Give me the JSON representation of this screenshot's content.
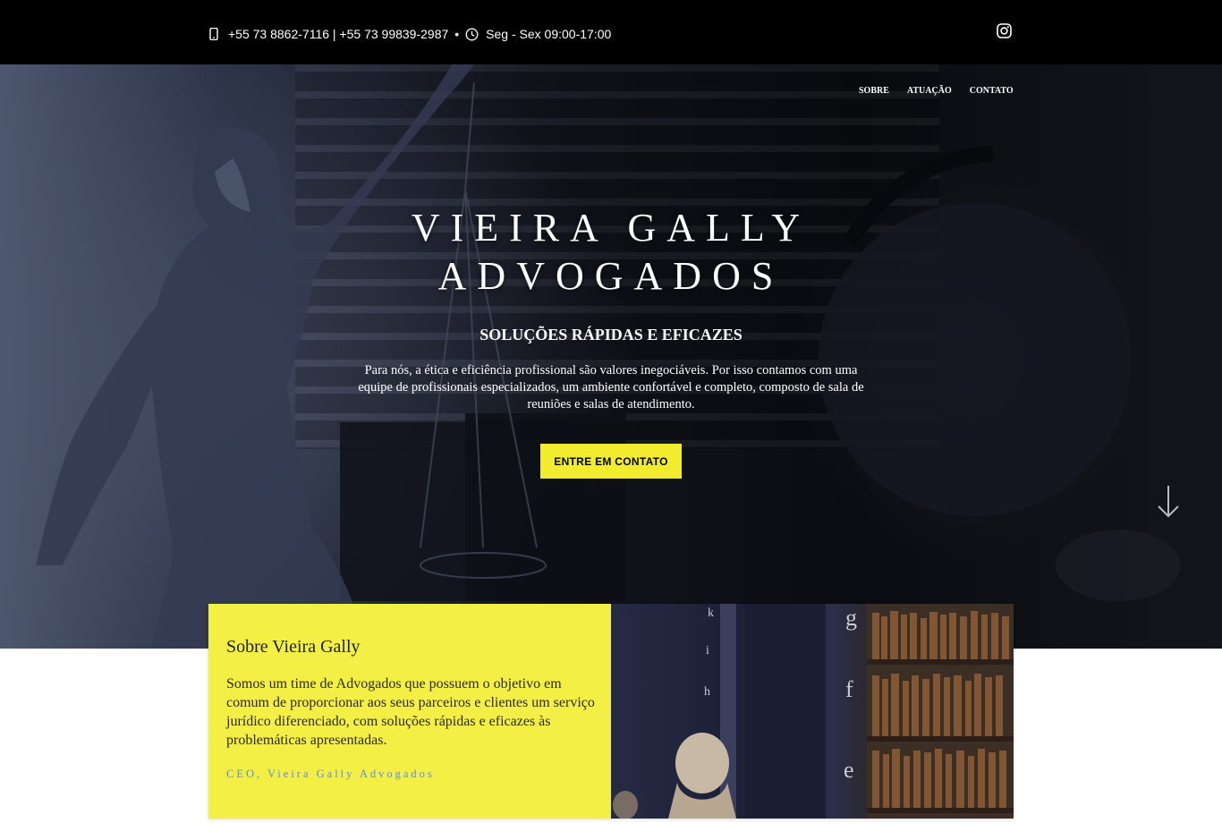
{
  "topbar": {
    "phones": "+55 73 8862-7116 | +55 73 99839-2987",
    "separator": "•",
    "hours": "Seg - Sex 09:00-17:00",
    "icons": [
      "phone-icon",
      "clock-icon",
      "instagram-icon"
    ]
  },
  "nav": {
    "items": [
      {
        "label": "SOBRE"
      },
      {
        "label": "ATUAÇÃO"
      },
      {
        "label": "CONTATO"
      }
    ]
  },
  "hero": {
    "title_line1": "VIEIRA GALLY",
    "title_line2": "ADVOGADOS",
    "subtitle": "SOLUÇÕES RÁPIDAS E EFICAZES",
    "text": "Para nós, a ética e eficiência profissional são valores inegociáveis. Por isso contamos com uma equipe de profissionais especializados, um ambiente confortável e completo, composto de sala de reuniões e salas de atendimento.",
    "cta_label": "ENTRE EM CONTATO"
  },
  "about": {
    "title": "Sobre Vieira Gally",
    "text": "Somos um time de Advogados que possuem o objetivo em comum de proporcionar aos seus parceiros e clientes um serviço jurídico diferenciado, com soluções rápidas e eficazes às problemáticas apresentadas.",
    "signature": "CEO, Vieira Gally Advogados",
    "image_letters": [
      "k",
      "i",
      "h",
      "g",
      "f",
      "e"
    ]
  },
  "colors": {
    "topbar_bg": "#000000",
    "accent_yellow": "#f2ec2e",
    "card_yellow": "#f3ef44",
    "signature_blue": "#5b8fd6"
  }
}
